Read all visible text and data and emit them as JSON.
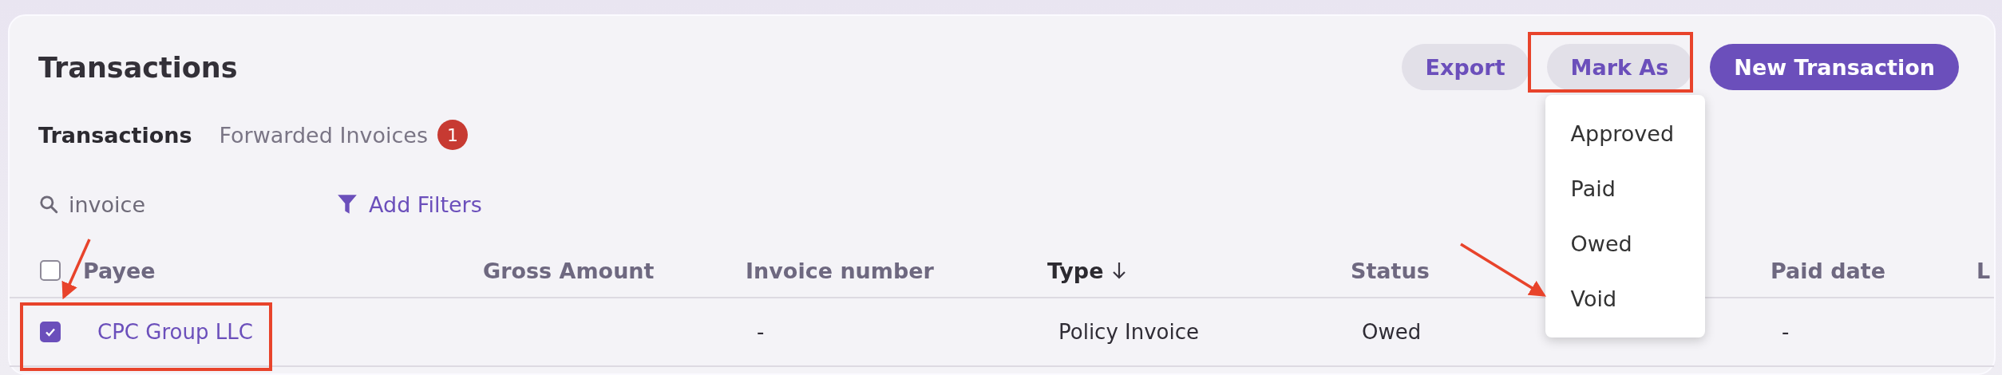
{
  "page": {
    "title": "Transactions"
  },
  "actions": [
    {
      "label": "Export",
      "kind": "secondary"
    },
    {
      "label": "Mark As",
      "kind": "secondary",
      "expanded": true
    },
    {
      "label": "New Transaction",
      "kind": "primary"
    }
  ],
  "menu": {
    "items": [
      "Approved",
      "Paid",
      "Owed",
      "Void"
    ]
  },
  "tabs": [
    {
      "label": "Transactions",
      "selected": true
    },
    {
      "label": "Forwarded Invoices",
      "selected": false,
      "badge": "1"
    }
  ],
  "search": {
    "value": "invoice"
  },
  "filters": {
    "label": "Add Filters"
  },
  "table": {
    "select_all": {
      "checked": false
    },
    "columns": [
      {
        "label": "Payee",
        "sorted": false
      },
      {
        "label": "Gross Amount",
        "sorted": false
      },
      {
        "label": "Invoice number",
        "sorted": false
      },
      {
        "label": "Type",
        "sorted": true
      },
      {
        "label": "Status",
        "sorted": false
      },
      null,
      {
        "label": "Paid date",
        "sorted": false
      },
      {
        "label": "L",
        "sorted": false
      }
    ],
    "rows": [
      {
        "checked": true,
        "cells": [
          "CPC Group LLC",
          null,
          "-",
          "Policy Invoice",
          "Owed",
          null,
          "-",
          null
        ]
      }
    ]
  }
}
